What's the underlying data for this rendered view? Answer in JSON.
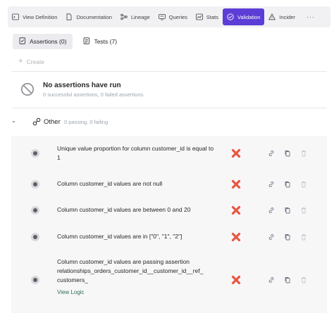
{
  "tabs": [
    {
      "label": "View Definition",
      "icon": "terminal-icon"
    },
    {
      "label": "Documentation",
      "icon": "document-icon"
    },
    {
      "label": "Lineage",
      "icon": "lineage-icon"
    },
    {
      "label": "Queries",
      "icon": "queries-icon"
    },
    {
      "label": "Stats",
      "icon": "stats-icon"
    },
    {
      "label": "Validation",
      "icon": "check-circle-icon",
      "active": true
    },
    {
      "label": "Incider",
      "icon": "warning-icon"
    }
  ],
  "tab_more": "···",
  "subtabs": [
    {
      "label": "Assertions (0)",
      "icon": "assertion-icon",
      "active": true
    },
    {
      "label": "Tests (7)",
      "icon": "test-icon"
    }
  ],
  "create_label": "Create",
  "empty_state": {
    "title": "No assertions have run",
    "subtitle": "0 successful assertions, 0 failed assertions."
  },
  "group": {
    "name": "Other",
    "summary": "0 passing, 0 failing"
  },
  "assertions": [
    {
      "text": "Unique value proportion for column customer_id is equal to 1",
      "status": "failed"
    },
    {
      "text": "Column customer_id values are not null",
      "status": "failed"
    },
    {
      "text": "Column customer_id values are between 0 and 20",
      "status": "failed"
    },
    {
      "text": "Column customer_id values are in [\"0\", \"1\", \"2\"]",
      "status": "failed"
    },
    {
      "text": "Column customer_id values are passing assertion relationships_orders_customer_id__customer_id__ref_ customers_",
      "status": "failed",
      "link": "View Logic"
    }
  ],
  "colors": {
    "accent": "#5c3ed6",
    "failure": "#e8573f",
    "link": "#2f6e54"
  }
}
